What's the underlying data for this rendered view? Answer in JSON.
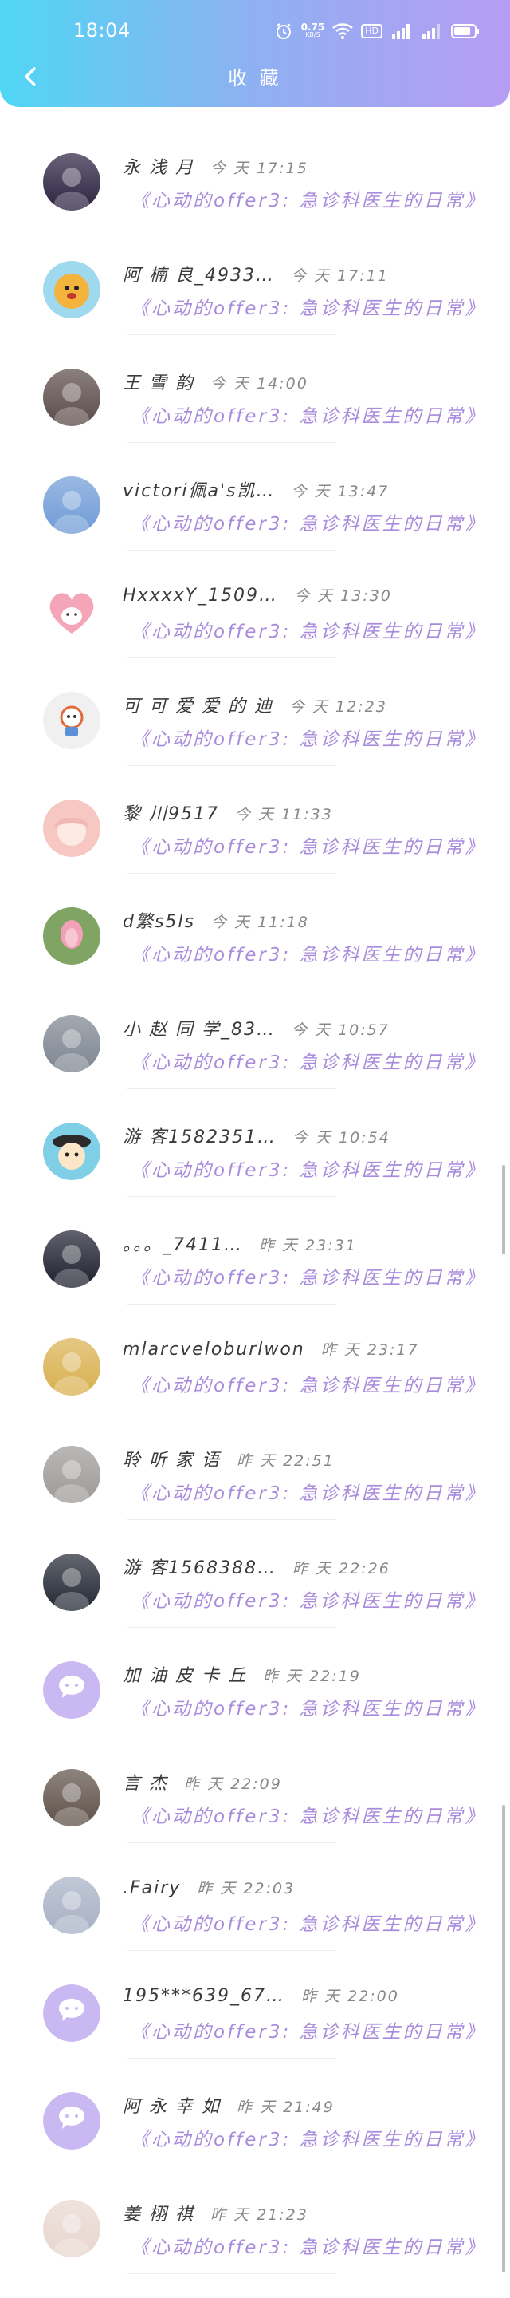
{
  "status_bar": {
    "time": "18:04",
    "net_speed_value": "0.75",
    "net_speed_unit": "KB/S",
    "hd": "HD"
  },
  "header": {
    "title": "收 藏",
    "back_icon": "chevron-left-icon"
  },
  "article_title": "《心动的offer3: 急诊科医生的日常》",
  "rows": [
    {
      "name": "永 浅 月",
      "time": "今 天 17:15",
      "avatar": "photo-dark",
      "color": "#2a2140"
    },
    {
      "name": "阿 楠 良_4933…",
      "time": "今 天 17:11",
      "avatar": "cartoon-dog",
      "color": "#f3b33d"
    },
    {
      "name": "王 雪 韵",
      "time": "今 天 14:00",
      "avatar": "photo-girl",
      "color": "#5a4a48"
    },
    {
      "name": "victori佩a's凯…",
      "time": "今 天 13:47",
      "avatar": "photo-sky",
      "color": "#6f9bd6"
    },
    {
      "name": "HxxxxY_1509…",
      "time": "今 天 13:30",
      "avatar": "heart-bear",
      "color": "#f4a5b7"
    },
    {
      "name": "可 可 爱 爱 的 迪",
      "time": "今 天 12:23",
      "avatar": "astronaut-cartoon",
      "color": "#f0f0f0"
    },
    {
      "name": "黎 川9517",
      "time": "今 天 11:33",
      "avatar": "anime-girl",
      "color": "#f6c7c3"
    },
    {
      "name": "d繁s5ls",
      "time": "今 天 11:18",
      "avatar": "lotus",
      "color": "#7fa463"
    },
    {
      "name": "小 赵 同 学_83…",
      "time": "今 天 10:57",
      "avatar": "photo-sunset",
      "color": "#7d8590"
    },
    {
      "name": "游 客1582351…",
      "time": "今 天 10:54",
      "avatar": "cartoon-kid",
      "color": "#7fd0e6"
    },
    {
      "name": "。。。_7411…",
      "time": "昨 天 23:31",
      "avatar": "photo-anime-dark",
      "color": "#1e1f2e"
    },
    {
      "name": "mlarcveloburlwon",
      "time": "昨 天 23:17",
      "avatar": "game-art",
      "color": "#d9b04f"
    },
    {
      "name": "聆 听 家 语",
      "time": "昨 天 22:51",
      "avatar": "photo-man",
      "color": "#9c9a98"
    },
    {
      "name": "游 客1568388…",
      "time": "昨 天 22:26",
      "avatar": "photo-night",
      "color": "#222733"
    },
    {
      "name": "加 油 皮 卡 丘",
      "time": "昨 天 22:19",
      "avatar": "default-chat",
      "color": "#c9b8f2"
    },
    {
      "name": "言 杰",
      "time": "昨 天 22:09",
      "avatar": "photo-face",
      "color": "#5e5048"
    },
    {
      "name": ".Fairy",
      "time": "昨 天 22:03",
      "avatar": "photo-boy",
      "color": "#a7b0c4"
    },
    {
      "name": "195***639_67…",
      "time": "昨 天 22:00",
      "avatar": "default-chat",
      "color": "#c9b8f2"
    },
    {
      "name": "阿 永 幸 如",
      "time": "昨 天 21:49",
      "avatar": "default-chat",
      "color": "#c9b8f2"
    },
    {
      "name": "姜 栩 祺",
      "time": "昨 天 21:23",
      "avatar": "photo-girl-light",
      "color": "#e8d6cf"
    }
  ]
}
